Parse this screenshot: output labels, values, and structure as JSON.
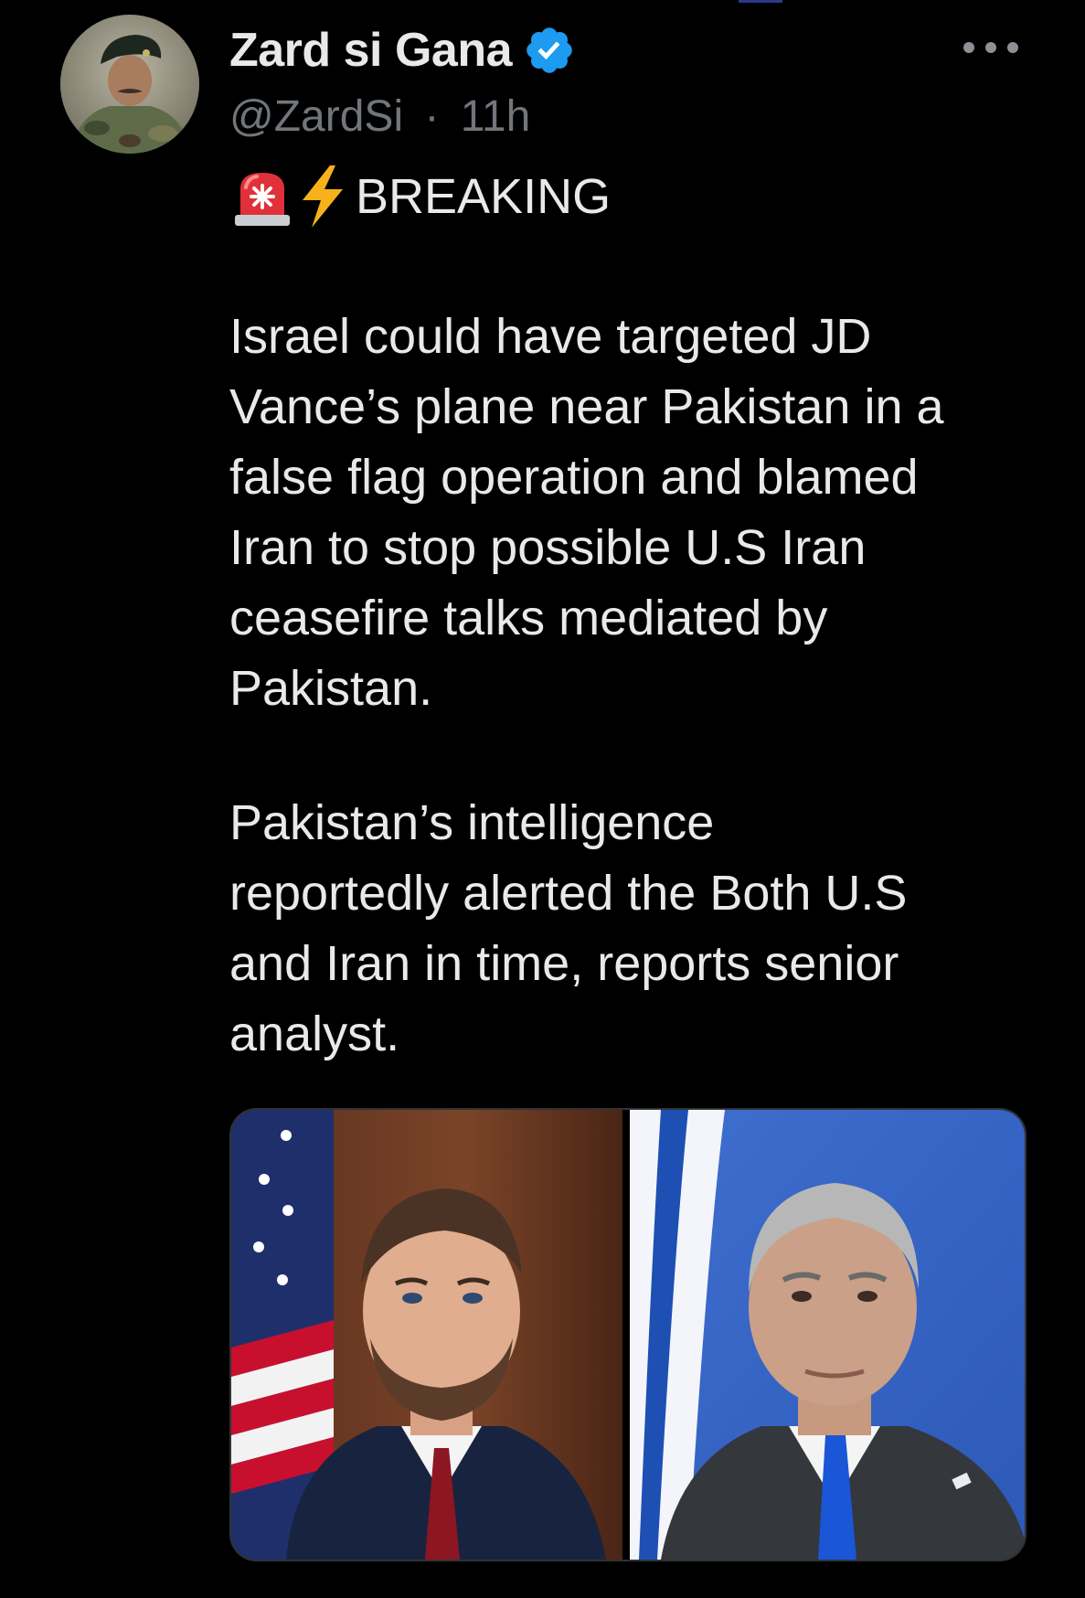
{
  "tweet": {
    "display_name": "Zard si Gana",
    "handle": "@ZardSi",
    "separator": "·",
    "time": "11h",
    "verified": true,
    "breaking_label": "BREAKING",
    "paragraphs": [
      "Israel could have targeted JD\nVance’s plane near Pakistan in a\nfalse flag operation and blamed\nIran to stop possible U.S Iran\nceasefire talks mediated by\nPakistan.",
      "Pakistan’s intelligence\nreportedly alerted the Both U.S\nand Iran in time, reports senior\nanalyst."
    ],
    "emojis": [
      "rotating-light-icon",
      "high-voltage-icon"
    ]
  },
  "colors": {
    "background": "#000000",
    "primary_text": "#e7e9ea",
    "secondary_text": "#71767b",
    "verified_badge": "#1d9bf0",
    "card_border": "#2f3336"
  },
  "media": {
    "images": [
      "portrait-photo-left",
      "portrait-photo-right"
    ]
  }
}
